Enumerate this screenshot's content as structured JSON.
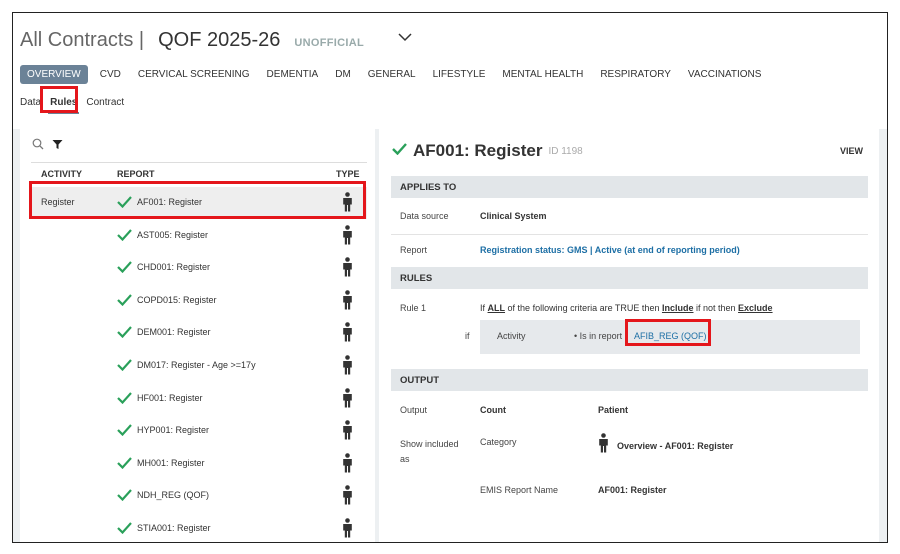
{
  "header": {
    "breadcrumb": "All Contracts |",
    "title": "QOF 2025-26",
    "badge": "UNOFFICIAL"
  },
  "tabs": [
    "OVERVIEW",
    "CVD",
    "CERVICAL SCREENING",
    "DEMENTIA",
    "DM",
    "GENERAL",
    "LIFESTYLE",
    "MENTAL HEALTH",
    "RESPIRATORY",
    "VACCINATIONS"
  ],
  "subtabs": [
    "Data",
    "Rules",
    "Contract"
  ],
  "list": {
    "columns": {
      "activity": "ACTIVITY",
      "report": "REPORT",
      "type": "TYPE"
    },
    "rows": [
      {
        "activity": "Register",
        "report": "AF001: Register"
      },
      {
        "activity": "",
        "report": "AST005: Register"
      },
      {
        "activity": "",
        "report": "CHD001: Register"
      },
      {
        "activity": "",
        "report": "COPD015: Register"
      },
      {
        "activity": "",
        "report": "DEM001: Register"
      },
      {
        "activity": "",
        "report": "DM017: Register - Age >=17y"
      },
      {
        "activity": "",
        "report": "HF001: Register"
      },
      {
        "activity": "",
        "report": "HYP001: Register"
      },
      {
        "activity": "",
        "report": "MH001: Register"
      },
      {
        "activity": "",
        "report": "NDH_REG (QOF)"
      },
      {
        "activity": "",
        "report": "STIA001: Register"
      }
    ]
  },
  "detail": {
    "title": "AF001: Register",
    "id": "ID 1198",
    "view": "VIEW",
    "applies_to": {
      "heading": "APPLIES TO",
      "data_source_label": "Data source",
      "data_source_value": "Clinical System",
      "report_label": "Report",
      "report_value": "Registration status: GMS | Active (at end of reporting period)"
    },
    "rules": {
      "heading": "RULES",
      "rule_label": "Rule 1",
      "text_if": "If",
      "text_all": "ALL",
      "text_mid": "of the following criteria are TRUE then",
      "text_include": "Include",
      "text_mid2": "if not then",
      "text_exclude": "Exclude",
      "if_label": "if",
      "criteria_field": "Activity",
      "criteria_text": "• Is in report",
      "criteria_link": "AFIB_REG (QOF)"
    },
    "output": {
      "heading": "OUTPUT",
      "output_label": "Output",
      "output_value": "Count",
      "output_unit": "Patient",
      "show_label": "Show included as",
      "category_label": "Category",
      "category_value": "Overview - AF001: Register",
      "emis_label": "EMIS Report Name",
      "emis_value": "AF001: Register"
    }
  },
  "colors": {
    "accent": "#6b8297",
    "check": "#2aa05a",
    "link": "#1d6fa5",
    "highlight": "#e4161b"
  }
}
